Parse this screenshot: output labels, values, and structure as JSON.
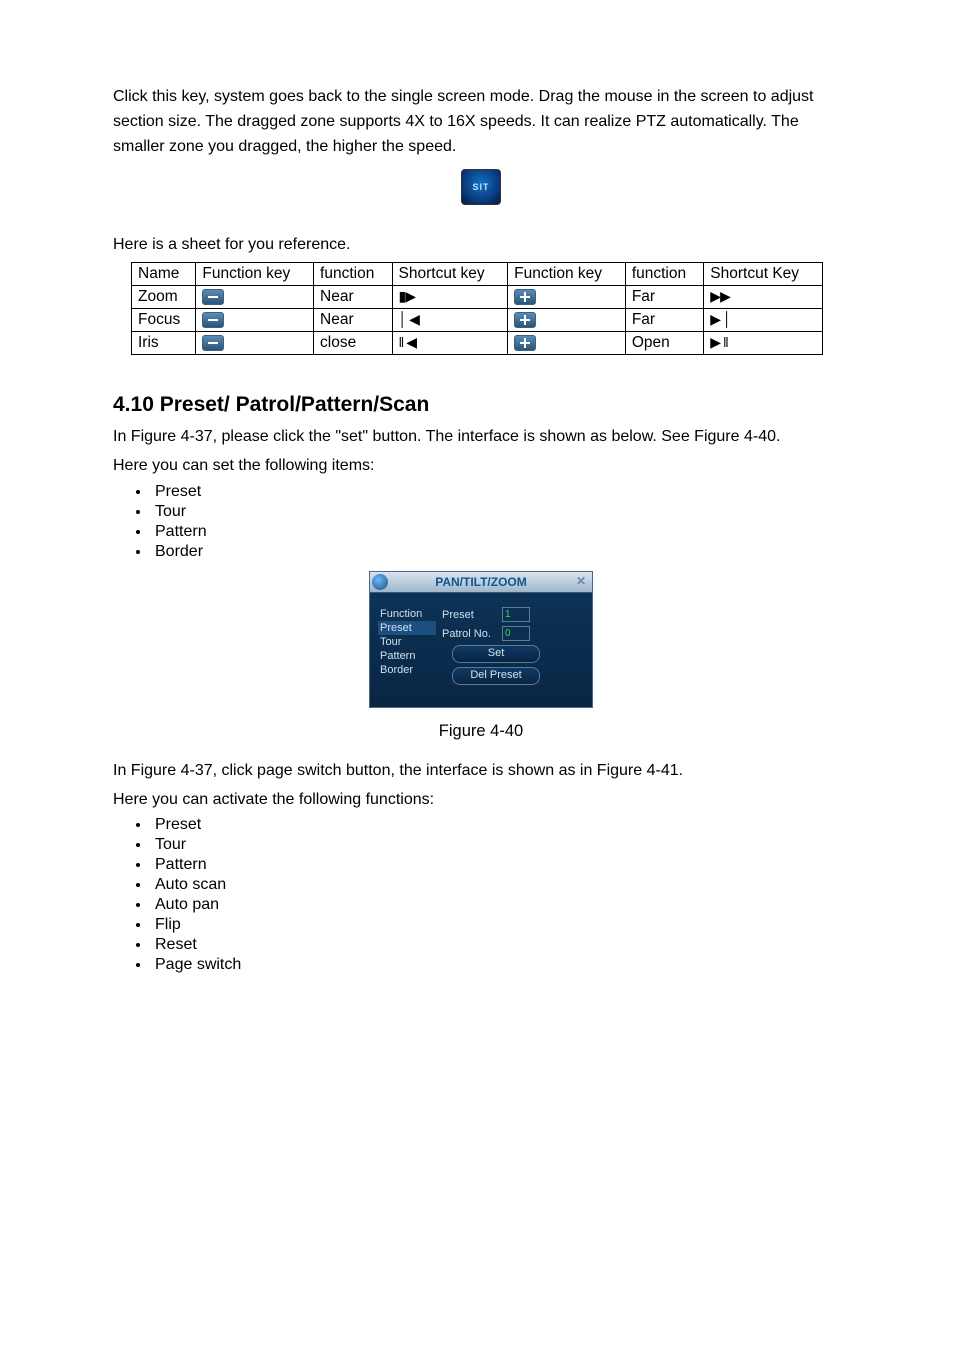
{
  "intro1": "Click this key, system goes back to the single screen mode. Drag the mouse in the screen to adjust section size.  The dragged zone supports 4X to 16X speeds. It can realize PTZ automatically. The smaller zone you dragged, the higher the speed.",
  "sit_label": "SIT",
  "table_lead": "Here is a sheet for you reference.",
  "table": {
    "headers": [
      "Name",
      "Function key",
      "function",
      "Shortcut key",
      "Function key",
      "function",
      "Shortcut Key"
    ],
    "rows": [
      {
        "name": "Zoom",
        "f1": "Near",
        "s1": "▮▶",
        "f2": "Far",
        "s2": "▶▶"
      },
      {
        "name": "Focus",
        "f1": "Near",
        "s1": "│ ◀",
        "f2": "Far",
        "s2": "▶ │"
      },
      {
        "name": "Iris",
        "f1": "close",
        "s1": "‖ ◀",
        "f2": "Open",
        "s2": "▶ ‖"
      }
    ]
  },
  "section_title": "4.10 Preset/ Patrol/Pattern/Scan",
  "section_p1": "In Figure 4-37, please click the \"set\" button. The interface is shown as below. See Figure 4-40.",
  "section_p2": "Here you can set the following items:",
  "list1": [
    "Preset",
    "Tour",
    "Pattern",
    "Border"
  ],
  "dialog": {
    "title": "PAN/TILT/ZOOM",
    "menu": [
      "Function",
      "Preset",
      "Tour",
      "Pattern",
      "Border"
    ],
    "fields": {
      "preset_label": "Preset",
      "preset_value": "1",
      "patrol_label": "Patrol No.",
      "patrol_value": "0"
    },
    "btn_set": "Set",
    "btn_del": "Del Preset"
  },
  "figcap": "Figure 4-40",
  "after1": "In  Figure 4-37, click page switch button, the interface is shown as in Figure 4-41.",
  "after2": "Here you can activate the following functions:",
  "list2": [
    "Preset",
    "Tour",
    "Pattern",
    "Auto scan",
    "Auto pan",
    "Flip",
    "Reset",
    "Page switch"
  ]
}
